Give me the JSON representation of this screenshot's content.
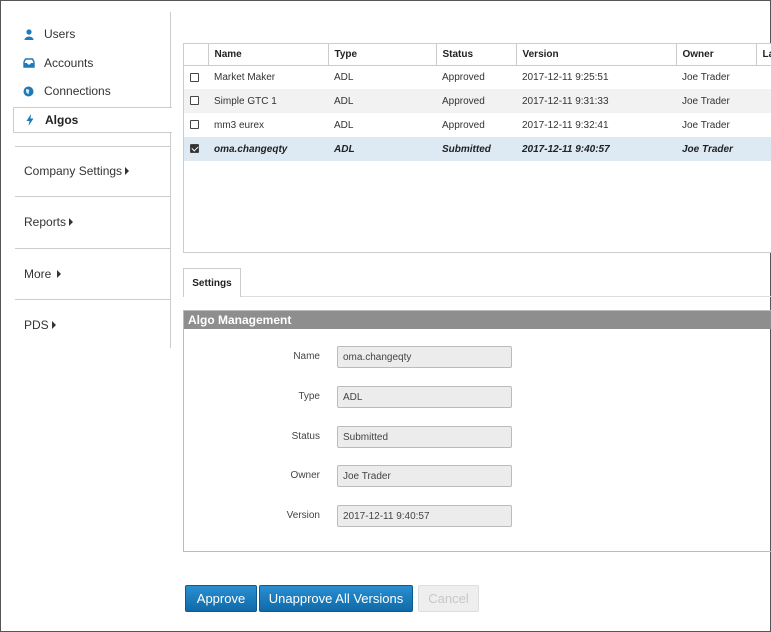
{
  "sidebar": {
    "items": [
      {
        "label": "Users",
        "icon": "user-icon"
      },
      {
        "label": "Accounts",
        "icon": "inbox-icon"
      },
      {
        "label": "Connections",
        "icon": "globe-icon"
      },
      {
        "label": "Algos",
        "icon": "bolt-icon",
        "active": true
      }
    ],
    "groups": [
      {
        "label": "Company Settings"
      },
      {
        "label": "Reports"
      },
      {
        "label": "More"
      },
      {
        "label": "PDS"
      }
    ]
  },
  "grid": {
    "columns": [
      "Name",
      "Type",
      "Status",
      "Version",
      "Owner",
      "La"
    ],
    "rows": [
      {
        "name": "Market Maker",
        "type": "ADL",
        "status": "Approved",
        "version": "2017-12-11 9:25:51",
        "owner": "Joe Trader",
        "checked": false
      },
      {
        "name": "Simple GTC 1",
        "type": "ADL",
        "status": "Approved",
        "version": "2017-12-11 9:31:33",
        "owner": "Joe Trader",
        "checked": false
      },
      {
        "name": "mm3 eurex",
        "type": "ADL",
        "status": "Approved",
        "version": "2017-12-11 9:32:41",
        "owner": "Joe Trader",
        "checked": false
      },
      {
        "name": "oma.changeqty",
        "type": "ADL",
        "status": "Submitted",
        "version": "2017-12-11 9:40:57",
        "owner": "Joe Trader",
        "checked": true
      }
    ]
  },
  "tabs": [
    {
      "label": "Settings"
    }
  ],
  "panel": {
    "title": "Algo Management",
    "fields": [
      {
        "label": "Name",
        "value": "oma.changeqty"
      },
      {
        "label": "Type",
        "value": "ADL"
      },
      {
        "label": "Status",
        "value": "Submitted"
      },
      {
        "label": "Owner",
        "value": "Joe Trader"
      },
      {
        "label": "Version",
        "value": "2017-12-11 9:40:57"
      }
    ]
  },
  "buttons": {
    "approve": "Approve",
    "unapprove_all": "Unapprove All Versions",
    "cancel": "Cancel"
  },
  "colors": {
    "accent": "#1f7ab8",
    "selected_row": "#dde9f3",
    "panel_header": "#8e8e8e"
  }
}
